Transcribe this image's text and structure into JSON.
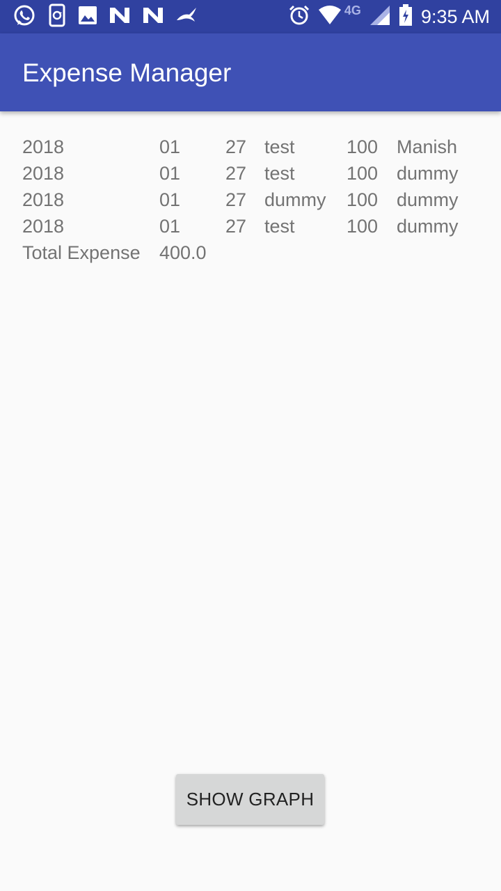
{
  "status_bar": {
    "time": "9:35 AM",
    "network": "4G",
    "left_icons": [
      "whatsapp-icon",
      "phone-sync-icon",
      "image-icon",
      "n-icon",
      "n-icon",
      "bird-icon"
    ],
    "right_icons": [
      "alarm-icon",
      "wifi-icon",
      "signal-icon",
      "battery-icon"
    ]
  },
  "app_bar": {
    "title": "Expense Manager"
  },
  "expenses": [
    {
      "year": "2018",
      "month": "01",
      "day": "27",
      "desc": "test",
      "amount": "100",
      "name": "Manish"
    },
    {
      "year": "2018",
      "month": "01",
      "day": "27",
      "desc": "test",
      "amount": "100",
      "name": "dummy"
    },
    {
      "year": "2018",
      "month": "01",
      "day": "27",
      "desc": "dummy",
      "amount": "100",
      "name": "dummy"
    },
    {
      "year": "2018",
      "month": "01",
      "day": "27",
      "desc": "test",
      "amount": "100",
      "name": "dummy"
    }
  ],
  "total": {
    "label": "Total Expense",
    "value": "400.0"
  },
  "button": {
    "label": "SHOW GRAPH"
  },
  "colors": {
    "status_bar": "#3041a0",
    "app_bar": "#3f51b5",
    "text": "#737373",
    "button": "#d6d7d7"
  }
}
